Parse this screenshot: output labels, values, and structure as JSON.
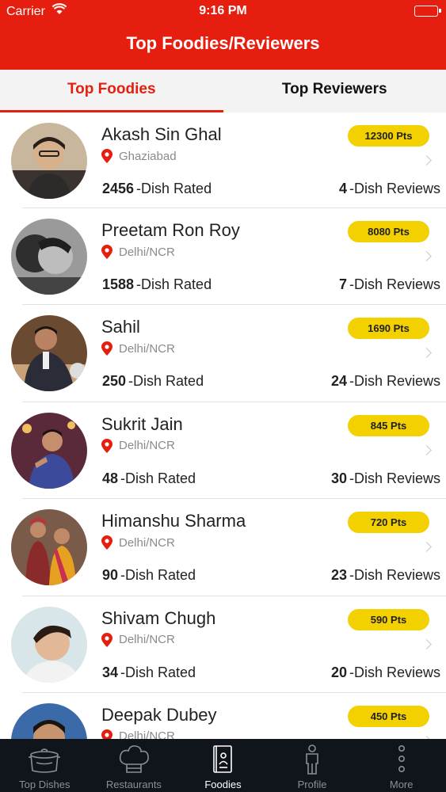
{
  "status_bar": {
    "carrier": "Carrier",
    "time": "9:16 PM"
  },
  "header": {
    "title": "Top Foodies/Reviewers"
  },
  "tabs": [
    {
      "label": "Top Foodies",
      "active": true
    },
    {
      "label": "Top Reviewers",
      "active": false
    }
  ],
  "foodies": [
    {
      "name": "Akash Sin Ghal",
      "location": "Ghaziabad",
      "points": "12300 Pts",
      "dish_rated": "2456",
      "dish_rated_label": "-Dish Rated",
      "dish_reviews": "4",
      "dish_reviews_label": "-Dish Reviews"
    },
    {
      "name": "Preetam Ron Roy",
      "location": "Delhi/NCR",
      "points": "8080 Pts",
      "dish_rated": "1588",
      "dish_rated_label": "-Dish Rated",
      "dish_reviews": "7",
      "dish_reviews_label": "-Dish Reviews"
    },
    {
      "name": "Sahil",
      "location": "Delhi/NCR",
      "points": "1690 Pts",
      "dish_rated": "250",
      "dish_rated_label": "-Dish Rated",
      "dish_reviews": "24",
      "dish_reviews_label": "-Dish Reviews"
    },
    {
      "name": "Sukrit Jain",
      "location": "Delhi/NCR",
      "points": "845 Pts",
      "dish_rated": "48",
      "dish_rated_label": "-Dish Rated",
      "dish_reviews": "30",
      "dish_reviews_label": "-Dish Reviews"
    },
    {
      "name": "Himanshu Sharma",
      "location": "Delhi/NCR",
      "points": "720 Pts",
      "dish_rated": "90",
      "dish_rated_label": "-Dish Rated",
      "dish_reviews": "23",
      "dish_reviews_label": "-Dish Reviews"
    },
    {
      "name": "Shivam Chugh",
      "location": "Delhi/NCR",
      "points": "590 Pts",
      "dish_rated": "34",
      "dish_rated_label": "-Dish Rated",
      "dish_reviews": "20",
      "dish_reviews_label": "-Dish Reviews"
    },
    {
      "name": "Deepak Dubey",
      "location": "Delhi/NCR",
      "points": "450 Pts",
      "dish_rated": "",
      "dish_rated_label": "",
      "dish_reviews": "",
      "dish_reviews_label": ""
    }
  ],
  "tabbar": [
    {
      "label": "Top Dishes",
      "icon": "pot-icon",
      "active": false
    },
    {
      "label": "Restaurants",
      "icon": "chef-hat-icon",
      "active": false
    },
    {
      "label": "Foodies",
      "icon": "book-icon",
      "active": true
    },
    {
      "label": "Profile",
      "icon": "person-icon",
      "active": false
    },
    {
      "label": "More",
      "icon": "more-dots-icon",
      "active": false
    }
  ],
  "colors": {
    "brand": "#e51e0f",
    "points_badge": "#f3d000",
    "tabbar_bg": "#10151c"
  }
}
